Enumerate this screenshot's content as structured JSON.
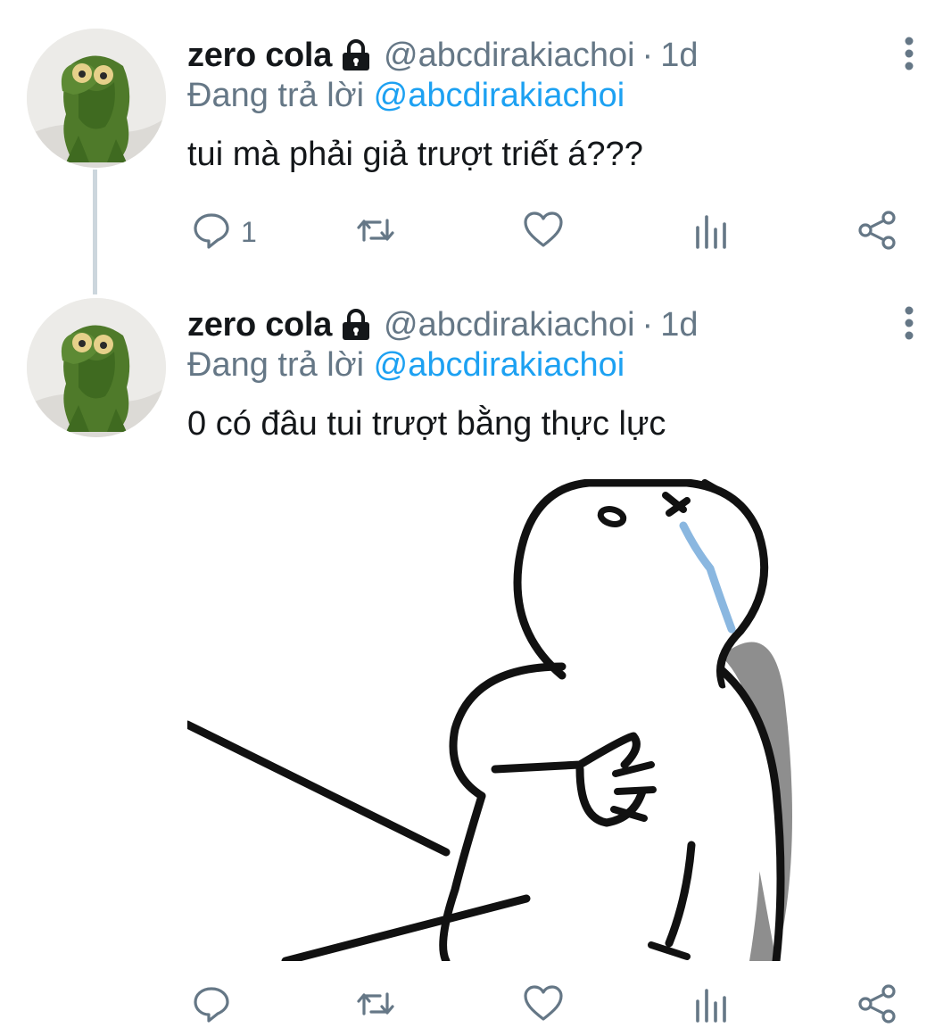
{
  "tweets": [
    {
      "name": "zero cola",
      "handle": "@abcdirakiachoi",
      "dot": "·",
      "time": "1d",
      "replying_prefix": "Đang trả lời",
      "replying_to": "@abcdirakiachoi",
      "text": "tui mà phải giả trượt triết á???",
      "reply_count": "1"
    },
    {
      "name": "zero cola",
      "handle": "@abcdirakiachoi",
      "dot": "·",
      "time": "1d",
      "replying_prefix": "Đang trả lời",
      "replying_to": "@abcdirakiachoi",
      "text": "0 có đâu tui trượt bằng thực lực",
      "reply_count": ""
    }
  ],
  "colors": {
    "text": "#14171a",
    "secondary": "#657786",
    "accent": "#1da1f2",
    "thread_line": "#ccd6dd"
  },
  "icons": [
    "lock-icon",
    "more-vertical-icon",
    "reply-icon",
    "retweet-icon",
    "like-icon",
    "analytics-icon",
    "share-icon"
  ]
}
